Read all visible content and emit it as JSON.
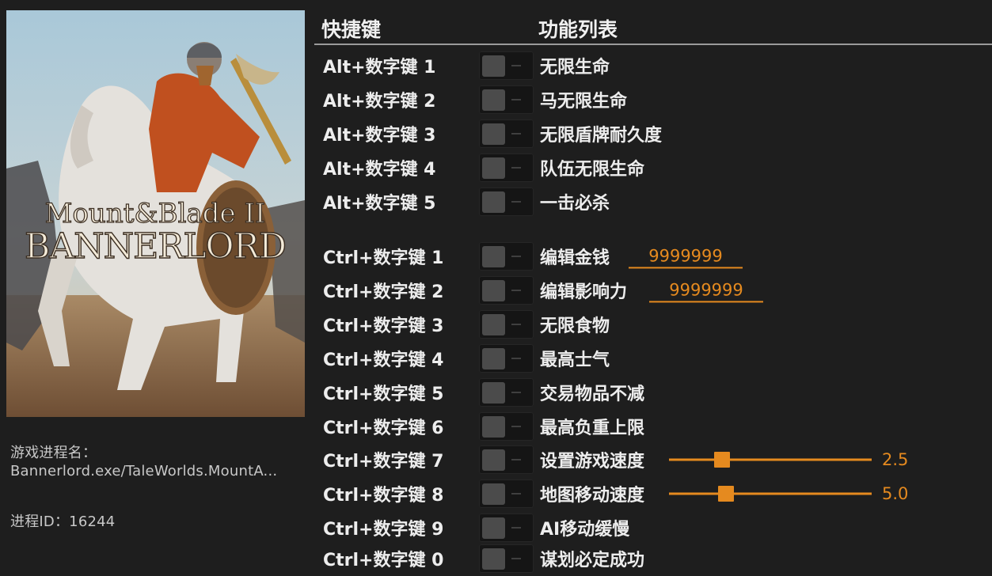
{
  "game": {
    "logo_line1": "Mount&Blade II",
    "logo_line2": "BANNERLORD",
    "process_label": "游戏进程名：",
    "process_name": "Bannerlord.exe/TaleWorlds.MountA...",
    "pid_label": "进程ID：16244"
  },
  "header": {
    "hotkey": "快捷键",
    "functions": "功能列表"
  },
  "rows": [
    {
      "key": "Alt+数字键 1",
      "func": "无限生命",
      "on": false
    },
    {
      "key": "Alt+数字键 2",
      "func": "马无限生命",
      "on": false
    },
    {
      "key": "Alt+数字键 3",
      "func": "无限盾牌耐久度",
      "on": false
    },
    {
      "key": "Alt+数字键 4",
      "func": "队伍无限生命",
      "on": false
    },
    {
      "key": "Alt+数字键 5",
      "func": "一击必杀",
      "on": false
    },
    {
      "key": "Ctrl+数字键 1",
      "func": "编辑金钱",
      "value": "9999999",
      "on": false
    },
    {
      "key": "Ctrl+数字键 2",
      "func": "编辑影响力",
      "value": "9999999",
      "on": false
    },
    {
      "key": "Ctrl+数字键 3",
      "func": "无限食物",
      "on": false
    },
    {
      "key": "Ctrl+数字键 4",
      "func": "最高士气",
      "on": false
    },
    {
      "key": "Ctrl+数字键 5",
      "func": "交易物品不减",
      "on": false
    },
    {
      "key": "Ctrl+数字键 6",
      "func": "最高负重上限",
      "on": false
    },
    {
      "key": "Ctrl+数字键 7",
      "func": "设置游戏速度",
      "slider_value": "2.5",
      "slider_fraction": 0.26,
      "on": false
    },
    {
      "key": "Ctrl+数字键 8",
      "func": "地图移动速度",
      "slider_value": "5.0",
      "slider_fraction": 0.28,
      "on": false
    },
    {
      "key": "Ctrl+数字键 9",
      "func": "AI移动缓慢",
      "on": false
    },
    {
      "key": "Ctrl+数字键 0",
      "func": "谋划必定成功",
      "on": false
    }
  ],
  "colors": {
    "accent": "#e58a1f",
    "background": "#1e1e1e",
    "toggle_off": "#4b4b4b"
  }
}
